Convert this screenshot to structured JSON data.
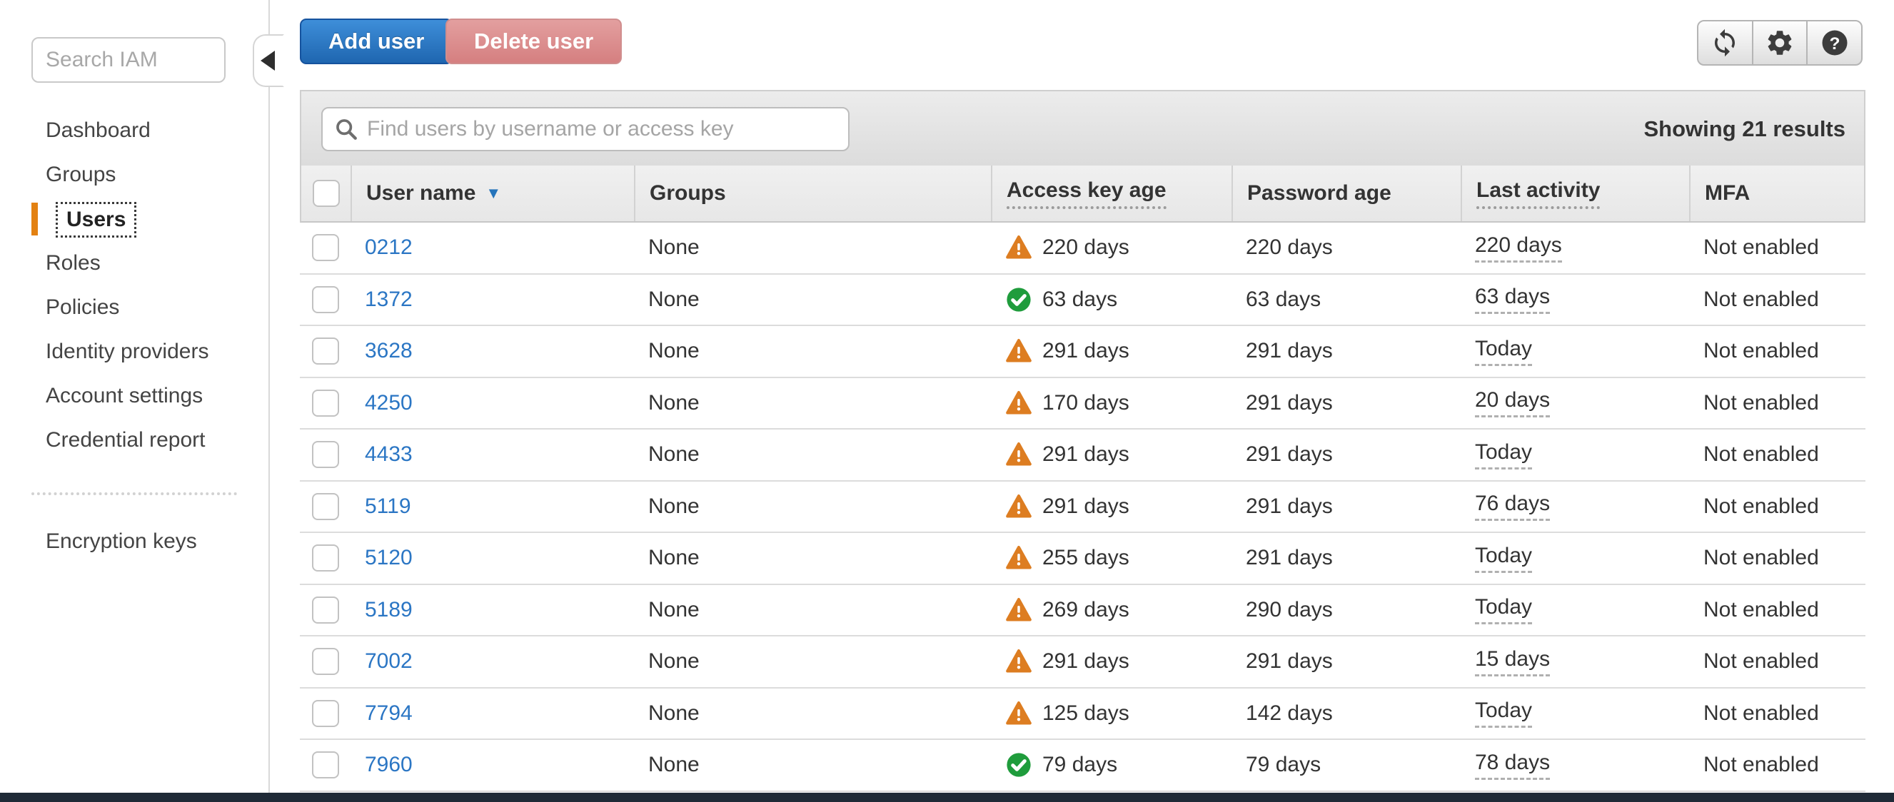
{
  "sidebar": {
    "search_placeholder": "Search IAM",
    "items": [
      {
        "label": "Dashboard",
        "selected": false
      },
      {
        "label": "Groups",
        "selected": false
      },
      {
        "label": "Users",
        "selected": true
      },
      {
        "label": "Roles",
        "selected": false
      },
      {
        "label": "Policies",
        "selected": false
      },
      {
        "label": "Identity providers",
        "selected": false
      },
      {
        "label": "Account settings",
        "selected": false
      },
      {
        "label": "Credential report",
        "selected": false
      }
    ],
    "footer_items": [
      {
        "label": "Encryption keys"
      }
    ]
  },
  "toolbar": {
    "add_user_label": "Add user",
    "delete_user_label": "Delete user",
    "icons": [
      "refresh-icon",
      "gear-icon",
      "help-icon"
    ]
  },
  "filter": {
    "placeholder": "Find users by username or access key",
    "results_text": "Showing 21 results"
  },
  "table": {
    "columns": [
      {
        "label": "",
        "type": "checkbox"
      },
      {
        "label": "User name",
        "sort": "desc"
      },
      {
        "label": "Groups"
      },
      {
        "label": "Access key age",
        "tooltip_underline": true
      },
      {
        "label": "Password age"
      },
      {
        "label": "Last activity",
        "tooltip_underline": true
      },
      {
        "label": "MFA"
      }
    ],
    "rows": [
      {
        "user_name": "0212",
        "groups": "None",
        "access_key_age": {
          "status": "warning",
          "text": "220 days"
        },
        "password_age": "220 days",
        "last_activity": "220 days",
        "mfa": "Not enabled"
      },
      {
        "user_name": "1372",
        "groups": "None",
        "access_key_age": {
          "status": "ok",
          "text": "63 days"
        },
        "password_age": "63 days",
        "last_activity": "63 days",
        "mfa": "Not enabled"
      },
      {
        "user_name": "3628",
        "groups": "None",
        "access_key_age": {
          "status": "warning",
          "text": "291 days"
        },
        "password_age": "291 days",
        "last_activity": "Today",
        "mfa": "Not enabled"
      },
      {
        "user_name": "4250",
        "groups": "None",
        "access_key_age": {
          "status": "warning",
          "text": "170 days"
        },
        "password_age": "291 days",
        "last_activity": "20 days",
        "mfa": "Not enabled"
      },
      {
        "user_name": "4433",
        "groups": "None",
        "access_key_age": {
          "status": "warning",
          "text": "291 days"
        },
        "password_age": "291 days",
        "last_activity": "Today",
        "mfa": "Not enabled"
      },
      {
        "user_name": "5119",
        "groups": "None",
        "access_key_age": {
          "status": "warning",
          "text": "291 days"
        },
        "password_age": "291 days",
        "last_activity": "76 days",
        "mfa": "Not enabled"
      },
      {
        "user_name": "5120",
        "groups": "None",
        "access_key_age": {
          "status": "warning",
          "text": "255 days"
        },
        "password_age": "291 days",
        "last_activity": "Today",
        "mfa": "Not enabled"
      },
      {
        "user_name": "5189",
        "groups": "None",
        "access_key_age": {
          "status": "warning",
          "text": "269 days"
        },
        "password_age": "290 days",
        "last_activity": "Today",
        "mfa": "Not enabled"
      },
      {
        "user_name": "7002",
        "groups": "None",
        "access_key_age": {
          "status": "warning",
          "text": "291 days"
        },
        "password_age": "291 days",
        "last_activity": "15 days",
        "mfa": "Not enabled"
      },
      {
        "user_name": "7794",
        "groups": "None",
        "access_key_age": {
          "status": "warning",
          "text": "125 days"
        },
        "password_age": "142 days",
        "last_activity": "Today",
        "mfa": "Not enabled"
      },
      {
        "user_name": "7960",
        "groups": "None",
        "access_key_age": {
          "status": "ok",
          "text": "79 days"
        },
        "password_age": "79 days",
        "last_activity": "78 days",
        "mfa": "Not enabled"
      }
    ]
  },
  "colors": {
    "accent_orange": "#e38112",
    "link_blue": "#2b76c4",
    "warning_orange": "#dd7d21",
    "success_green": "#1f9c3c",
    "button_primary_blue": "#1f66b0",
    "button_danger_pink": "#d57f80",
    "footer_dark": "#1f2a37"
  }
}
